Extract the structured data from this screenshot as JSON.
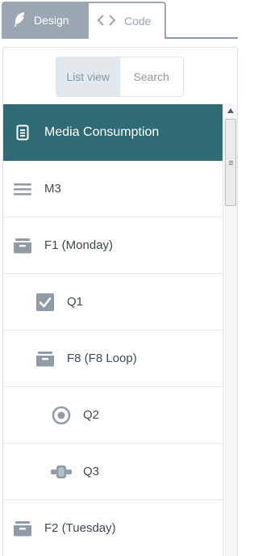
{
  "tabs": {
    "design_label": "Design",
    "code_label": "Code",
    "design_icon": "feather-icon",
    "code_icon": "code-brackets-icon"
  },
  "view_toggle": {
    "list_label": "List view",
    "search_label": "Search",
    "selected": "List view"
  },
  "tree": {
    "header": {
      "label": "Media Consumption",
      "icon": "document-icon"
    },
    "items": [
      {
        "label": "M3",
        "icon": "menu-lines-icon",
        "level": 0
      },
      {
        "label": "F1 (Monday)",
        "icon": "folder-tray-icon",
        "level": 0
      },
      {
        "label": "Q1",
        "icon": "checkbox-icon",
        "level": 1
      },
      {
        "label": "F8 (F8 Loop)",
        "icon": "folder-tray-icon",
        "level": 1
      },
      {
        "label": "Q2",
        "icon": "radio-icon",
        "level": 2
      },
      {
        "label": "Q3",
        "icon": "slider-icon",
        "level": 2
      },
      {
        "label": "F2 (Tuesday)",
        "icon": "folder-tray-icon",
        "level": 0
      }
    ]
  },
  "colors": {
    "header_bg": "#2e6b74",
    "tab_active_bg": "#9aa7b3",
    "icon_gray": "#8f9ca7"
  }
}
